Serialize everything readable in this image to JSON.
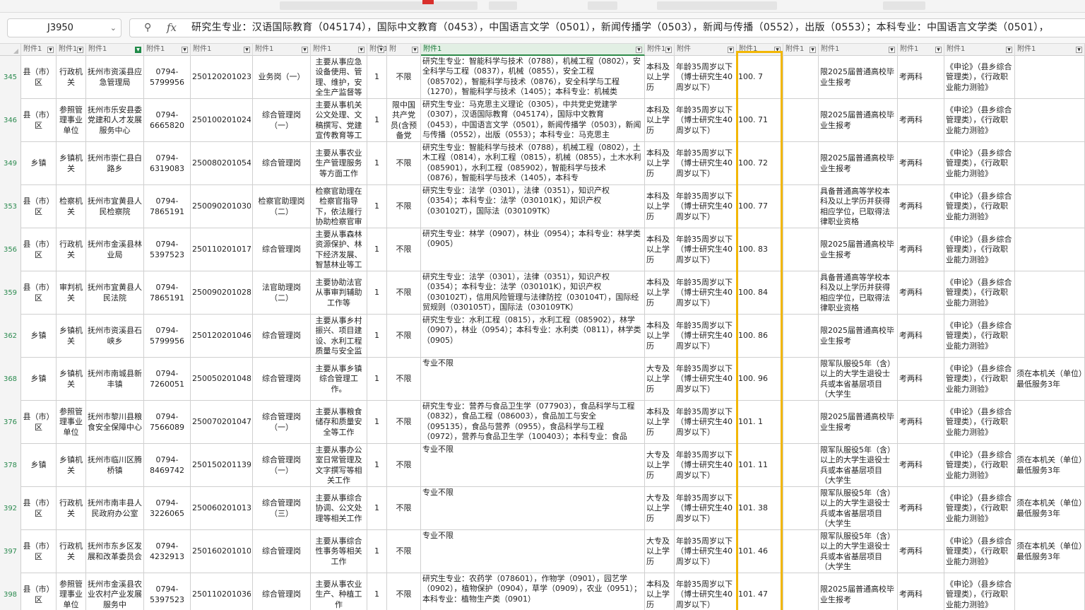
{
  "formula_bar": {
    "cell_ref": "J3950",
    "formula": "研究生专业：汉语国际教育（045174），国际中文教育（0453），中国语言文学（0501），新闻传播学（0503），新闻与传播（0552），出版（0553）；本科专业：中国语言文学类（0501），"
  },
  "headers": [
    "附件1",
    "附件1",
    "附件1",
    "附件1",
    "附件1",
    "附件1",
    "附件1",
    "附件1",
    "附",
    "附件1",
    "附件1",
    "附件",
    "附件1",
    "附件1",
    "附件1",
    "附件1",
    "附件1",
    "附件1",
    "附件1"
  ],
  "colors": {
    "highlight": "#f2b705",
    "row_number": "#2b8a4f",
    "filter_active": "#1f8a48"
  },
  "icons": {
    "zoom": "magnifier-icon",
    "fx": "function-icon"
  },
  "rows": [
    {
      "n": "345",
      "a": "县（市）区",
      "b": "行政机关",
      "c": "抚州市资溪县应急管理局",
      "d": "0794-5799956",
      "e": "250120201023",
      "f": "业务岗（一）",
      "g": "主要从事应急设备使用、管理、维护，安全生产监督等",
      "h": "1",
      "i": "不限",
      "j": "研究生专业：智能科学与技术（0788），机械工程（0802），安全科学与工程（0837），机械（0855），安全工程（085702），智能科学与技术（0876），安全科学与工程（1270），智能科学与技术（1405）；本科专业：机械类",
      "k": "本科及以上学历",
      "l": "年龄35周岁以下（博士研究生40周岁以下）",
      "m": "100. 7",
      "n2": "",
      "o": "限2025届普通高校毕业生报考",
      "p": "考两科",
      "q": "《申论》（县乡综合管理类），《行政职业能力测验》",
      "r": ""
    },
    {
      "n": "346",
      "a": "县（市）区",
      "b": "参照管理事业单位",
      "c": "抚州市乐安县委党建和人才发展服务中心",
      "d": "0794-6665820",
      "e": "250100201024",
      "f": "综合管理岗（一）",
      "g": "主要从事机关公文处理、文稿撰写、党建宣传教育等工",
      "h": "1",
      "i": "限中国共产党员(含预备党",
      "j": "研究生专业：马克思主义理论（0305），中共党史党建学（0307），汉语国际教育（045174），国际中文教育（0453），中国语言文学（0501），新闻传播学（0503），新闻与传播（0552），出版（0553）；本科专业：马克思主",
      "k": "本科及以上学历",
      "l": "年龄35周岁以下（博士研究生40周岁以下）",
      "m": "100. 71",
      "n2": "",
      "o": "限2025届普通高校毕业生报考",
      "p": "考两科",
      "q": "《申论》（县乡综合管理类），《行政职业能力测验》",
      "r": ""
    },
    {
      "n": "349",
      "a": "乡镇",
      "b": "乡镇机关",
      "c": "抚州市崇仁县白路乡",
      "d": "0794-6319083",
      "e": "250080201054",
      "f": "综合管理岗",
      "g": "主要从事农业生产管理服务等方面工作",
      "h": "1",
      "i": "不限",
      "j": "研究生专业：智能科学与技术（0788），机械工程（0802），土木工程（0814），水利工程（0815），机械（0855），土木水利（085901），水利工程（085902），智能科学与技术（0876），智能科学与技术（1405），本科专",
      "k": "本科及以上学历",
      "l": "年龄35周岁以下（博士研究生40周岁以下）",
      "m": "100. 72",
      "n2": "",
      "o": "限2025届普通高校毕业生报考",
      "p": "考两科",
      "q": "《申论》（县乡综合管理类），《行政职业能力测验》",
      "r": ""
    },
    {
      "n": "353",
      "a": "县（市）区",
      "b": "检察机关",
      "c": "抚州市宜黄县人民检察院",
      "d": "0794-7865191",
      "e": "250090201030",
      "f": "检察官助理岗（二）",
      "g": "检察官助理在检察官指导下，依法履行协助检察官审",
      "h": "1",
      "i": "不限",
      "j": "研究生专业：法学（0301），法律（0351），知识产权（0354）；本科专业：法学（030101K），知识产权（030102T），国际法（030109TK）",
      "k": "本科及以上学历",
      "l": "年龄35周岁以下（博士研究生40周岁以下）",
      "m": "100. 77",
      "n2": "",
      "o": "具备普通高等学校本科及以上学历并获得相应学位，已取得法律职业资格",
      "p": "考两科",
      "q": "《申论》（县乡综合管理类），《行政职业能力测验》",
      "r": ""
    },
    {
      "n": "356",
      "a": "县（市）区",
      "b": "行政机关",
      "c": "抚州市金溪县林业局",
      "d": "0794-5397523",
      "e": "250110201017",
      "f": "综合管理岗",
      "g": "主要从事森林资源保护、林下经济发展、智慧林业等工",
      "h": "1",
      "i": "不限",
      "j": "研究生专业：林学（0907），林业（0954）；本科专业：林学类（0905）",
      "k": "本科及以上学历",
      "l": "年龄35周岁以下（博士研究生40周岁以下）",
      "m": "100. 83",
      "n2": "",
      "o": "限2025届普通高校毕业生报考",
      "p": "考两科",
      "q": "《申论》（县乡综合管理类），《行政职业能力测验》",
      "r": ""
    },
    {
      "n": "359",
      "a": "县（市）区",
      "b": "审判机关",
      "c": "抚州市宜黄县人民法院",
      "d": "0794-7865191",
      "e": "250090201028",
      "f": "法官助理岗（二）",
      "g": "主要协助法官从事审判辅助工作等",
      "h": "1",
      "i": "不限",
      "j": "研究生专业：法学（0301），法律（0351），知识产权（0354）；本科专业：法学（030101K），知识产权（030102T），信用风险管理与法律防控（030104T），国际经贸规则（030105T），国际法（030109TK）",
      "k": "本科及以上学历",
      "l": "年龄35周岁以下（博士研究生40周岁以下）",
      "m": "100. 84",
      "n2": "",
      "o": "具备普通高等学校本科及以上学历并获得相应学位，已取得法律职业资格",
      "p": "考两科",
      "q": "《申论》（县乡综合管理类），《行政职业能力测验》",
      "r": ""
    },
    {
      "n": "362",
      "a": "乡镇",
      "b": "乡镇机关",
      "c": "抚州市资溪县石峡乡",
      "d": "0794-5799956",
      "e": "250120201046",
      "f": "综合管理岗",
      "g": "主要从事乡村振兴、项目建设、水利工程质量与安全监",
      "h": "1",
      "i": "不限",
      "j": "研究生专业：水利工程（0815），水利工程（085902），林学（0907），林业（0954）；本科专业：水利类（0811），林学类（0905）",
      "k": "本科及以上学历",
      "l": "年龄35周岁以下（博士研究生40周岁以下）",
      "m": "100. 86",
      "n2": "",
      "o": "限2025届普通高校毕业生报考",
      "p": "考两科",
      "q": "《申论》（县乡综合管理类），《行政职业能力测验》",
      "r": ""
    },
    {
      "n": "368",
      "a": "乡镇",
      "b": "乡镇机关",
      "c": "抚州市南城县新丰镇",
      "d": "0794-7260051",
      "e": "250050201048",
      "f": "综合管理岗",
      "g": "主要从事乡镇综合管理工作。",
      "h": "1",
      "i": "不限",
      "j": "专业不限",
      "k": "大专及以上学历",
      "l": "年龄35周岁以下（博士研究生40周岁以下）",
      "m": "100. 96",
      "n2": "",
      "o": "限军队服役5年（含）以上的大学生退役士兵或本省基层项目（大学生",
      "p": "考两科",
      "q": "《申论》（县乡综合管理类），《行政职业能力测验》",
      "r": "须在本机关（单位）最低服务3年"
    },
    {
      "n": "376",
      "a": "县（市）区",
      "b": "参照管理事业单位",
      "c": "抚州市黎川县粮食安全保障中心",
      "d": "0794-7566089",
      "e": "250070201047",
      "f": "综合管理岗（一）",
      "g": "主要从事粮食储存和质量安全等工作",
      "h": "1",
      "i": "不限",
      "j": "研究生专业：营养与食品卫生学（077903），食品科学与工程（0832），食品工程（086003），食品加工与安全（095135），食品与营养（0955），食品科学与工程（0972），营养与食品卫生学（100403）；本科专业：食品",
      "k": "本科及以上学历",
      "l": "年龄35周岁以下（博士研究生40周岁以下）",
      "m": "101. 1",
      "n2": "",
      "o": "限2025届普通高校毕业生报考",
      "p": "考两科",
      "q": "《申论》（县乡综合管理类），《行政职业能力测验》",
      "r": ""
    },
    {
      "n": "378",
      "a": "乡镇",
      "b": "乡镇机关",
      "c": "抚州市临川区腾桥镇",
      "d": "0794-8469742",
      "e": "250150201139",
      "f": "综合管理岗（一）",
      "g": "主要从事办公室日常管理及文字撰写等相关工作",
      "h": "1",
      "i": "不限",
      "j": "专业不限",
      "k": "大专及以上学历",
      "l": "年龄35周岁以下（博士研究生40周岁以下）",
      "m": "101. 11",
      "n2": "",
      "o": "限军队服役5年（含）以上的大学生退役士兵或本省基层项目（大学生",
      "p": "考两科",
      "q": "《申论》（县乡综合管理类），《行政职业能力测验》",
      "r": "须在本机关（单位）最低服务3年"
    },
    {
      "n": "392",
      "a": "县（市）区",
      "b": "行政机关",
      "c": "抚州市南丰县人民政府办公室",
      "d": "0794-3226065",
      "e": "250060201013",
      "f": "综合管理岗（三）",
      "g": "主要从事综合协调、公文处理等相关工作",
      "h": "1",
      "i": "不限",
      "j": "专业不限",
      "k": "大专及以上学历",
      "l": "年龄35周岁以下（博士研究生40周岁以下）",
      "m": "101. 38",
      "n2": "",
      "o": "限军队服役5年（含）以上的大学生退役士兵或本省基层项目（大学生",
      "p": "考两科",
      "q": "《申论》（县乡综合管理类），《行政职业能力测验》",
      "r": "须在本机关（单位）最低服务3年"
    },
    {
      "n": "397",
      "a": "县（市）区",
      "b": "行政机关",
      "c": "抚州市东乡区发展和改革委员会",
      "d": "0794-4232913",
      "e": "250160201010",
      "f": "综合管理岗",
      "g": "主要从事综合性事务等相关工作",
      "h": "1",
      "i": "不限",
      "j": "专业不限",
      "k": "大专及以上学历",
      "l": "年龄35周岁以下（博士研究生40周岁以下）",
      "m": "101. 46",
      "n2": "",
      "o": "限军队服役5年（含）以上的大学生退役士兵或本省基层项目（大学生",
      "p": "考两科",
      "q": "《申论》（县乡综合管理类），《行政职业能力测验》",
      "r": "须在本机关（单位）最低服务3年"
    },
    {
      "n": "398",
      "a": "县（市）区",
      "b": "参照管理事业单位",
      "c": "抚州市金溪县农业农村产业发展服务中",
      "d": "0794-5397523",
      "e": "250110201036",
      "f": "综合管理岗",
      "g": "主要从事农业生产、种植工作",
      "h": "1",
      "i": "不限",
      "j": "研究生专业：农药学（078601），作物学（0901），园艺学（0902），植物保护（0904），草学（0909），农业（0951）；本科专业：植物生产类（0901）",
      "k": "本科及以上学历",
      "l": "年龄35周岁以下（博士研究生40周岁以下）",
      "m": "101. 47",
      "n2": "",
      "o": "限2025届普通高校毕业生报考",
      "p": "考两科",
      "q": "《申论》（县乡综合管理类），《行政职业能力测验》",
      "r": ""
    }
  ]
}
